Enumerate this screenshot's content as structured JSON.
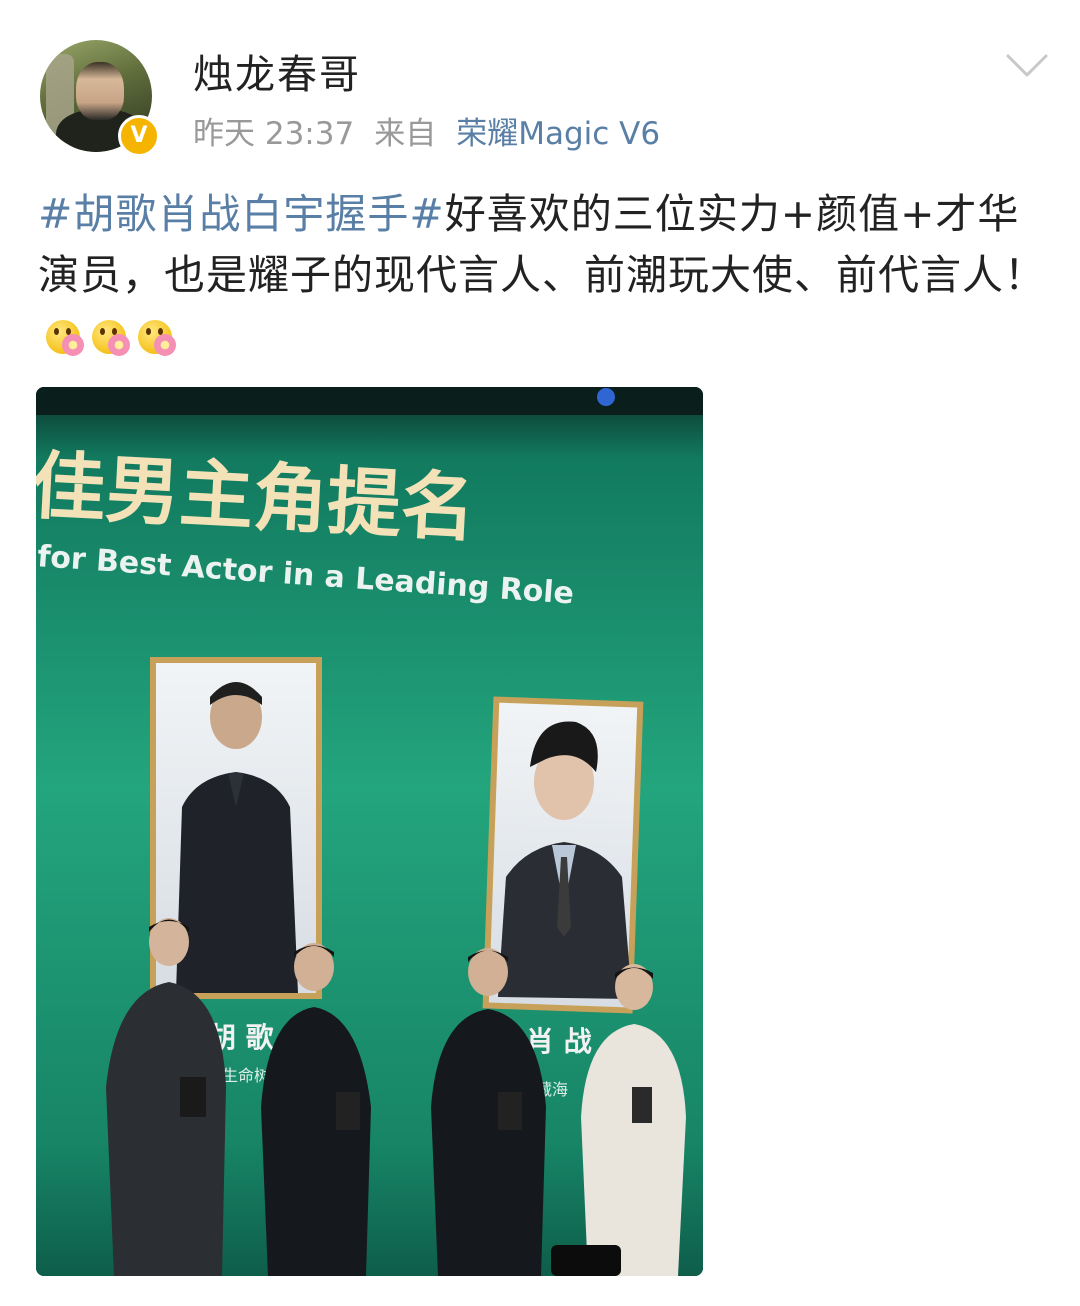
{
  "post": {
    "username": "烛龙春哥",
    "time": "昨天 23:37",
    "source_prefix": "来自",
    "device": "荣耀Magic V6",
    "verified_badge": "V",
    "hashtag": "#胡歌肖战白宇握手#",
    "text": "好喜欢的三位实力+颜值+才华演员，也是耀子的现代言人、前潮玩大使、前代言人！",
    "emoji_count": 3
  },
  "image": {
    "banner_title": "佳男主角提名",
    "banner_subtitle": "for Best Actor in a Leading Role",
    "nameplate_left": "胡 歌",
    "nameplate_left_sub": "生命树",
    "nameplate_right": "肖 战",
    "nameplate_right_sub": "藏海"
  },
  "colors": {
    "link": "#5a7fa6",
    "text": "#222222",
    "meta": "#999999",
    "verified": "#f5b400",
    "stage_green": "#1b8f6a"
  }
}
